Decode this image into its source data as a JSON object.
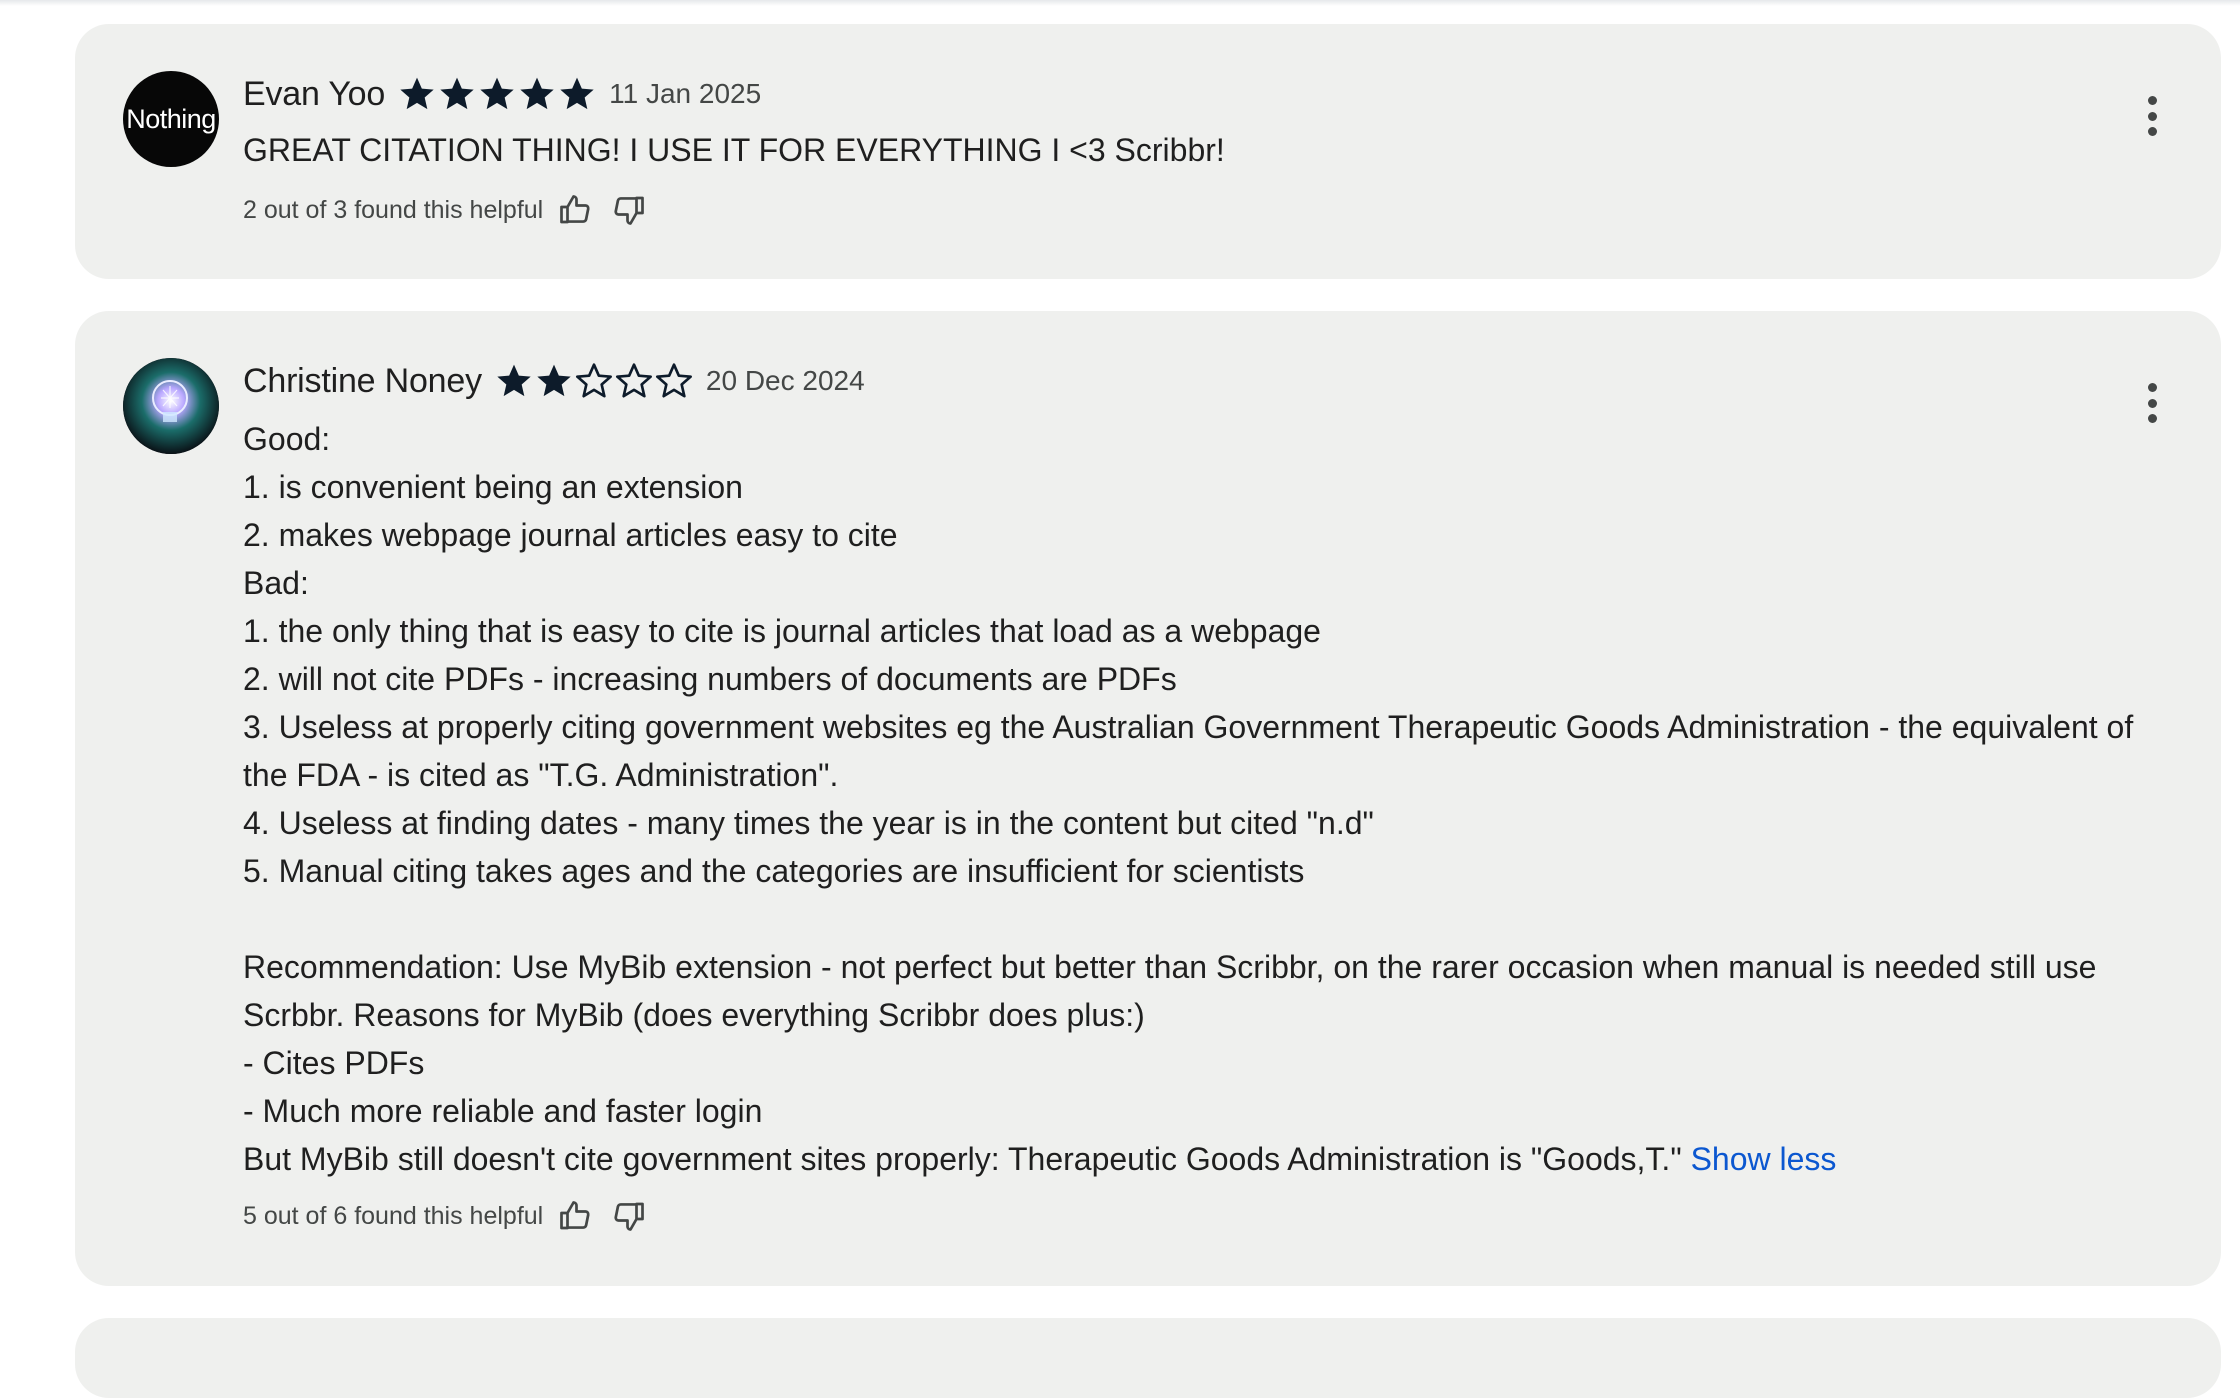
{
  "reviews": [
    {
      "author": "Evan Yoo",
      "rating": 5,
      "max_rating": 5,
      "date": "11 Jan 2025",
      "avatar_text": "Nothing",
      "text": "GREAT CITATION THING! I USE IT FOR EVERYTHING I <3 Scribbr!",
      "helpful": "2 out of 3 found this helpful"
    },
    {
      "author": "Christine Noney",
      "rating": 2,
      "max_rating": 5,
      "date": "20 Dec 2024",
      "avatar_icon": "lightbulb-avatar",
      "text": "Good:\n1. is convenient being an extension\n2. makes webpage journal articles easy to cite\nBad:\n1. the only thing that is easy to cite is journal articles that load as a webpage\n2. will not cite PDFs - increasing numbers of documents are PDFs\n3. Useless at properly citing government websites eg the Australian Government Therapeutic Goods Administration - the equivalent of the FDA - is cited as \"T.G. Administration\".\n4. Useless at finding dates - many times the year is in the content but cited \"n.d\"\n5. Manual citing takes ages and the categories are insufficient for scientists\n\nRecommendation: Use MyBib extension - not perfect but better than Scribbr, on the rarer occasion when manual is needed still use Scrbbr. Reasons for MyBib (does everything Scribbr does plus:)\n- Cites PDFs\n- Much more reliable and faster login\nBut MyBib still doesn't cite government sites properly: Therapeutic Goods Administration is \"Goods,T.\" ",
      "toggle_label": "Show less",
      "helpful": "5 out of 6 found this helpful"
    }
  ],
  "icons": {
    "star_filled": "star-icon",
    "star_empty": "star-outline-icon",
    "thumb_up": "thumb-up-icon",
    "thumb_down": "thumb-down-icon",
    "more": "more-vert-icon"
  },
  "colors": {
    "card_bg": "#eff0ee",
    "star": "#0d1b2a",
    "link": "#0b57d0",
    "muted": "#444746"
  }
}
